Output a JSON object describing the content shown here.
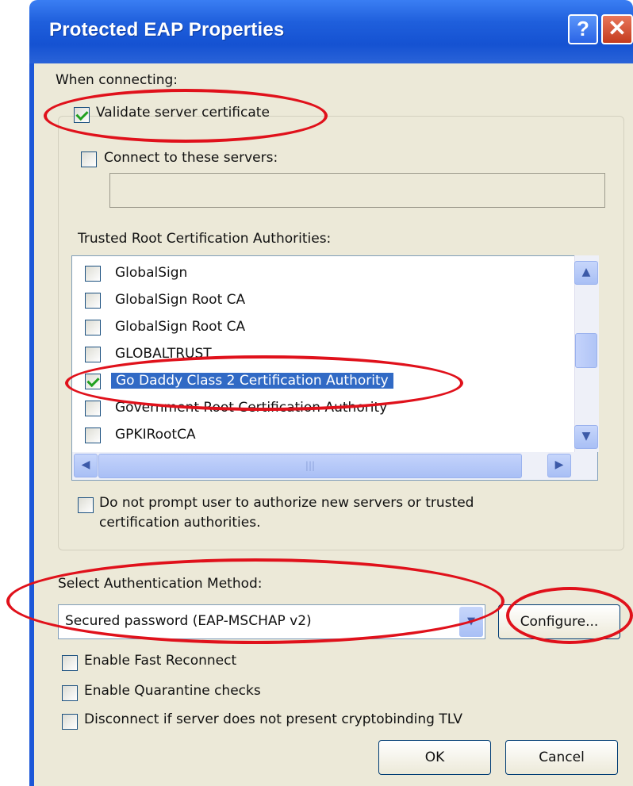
{
  "dialog": {
    "title": "Protected EAP Properties",
    "help_icon": "question-mark-icon",
    "close_icon": "close-x-icon"
  },
  "when_connecting": {
    "label": "When connecting:",
    "validate_cert": {
      "label": "Validate server certificate",
      "checked": true
    },
    "connect_servers": {
      "label": "Connect to these servers:",
      "checked": false,
      "value": ""
    }
  },
  "trusted_root": {
    "label": "Trusted Root Certification Authorities:",
    "items": [
      {
        "name": "GlobalSign",
        "checked": false,
        "selected": false
      },
      {
        "name": "GlobalSign Root CA",
        "checked": false,
        "selected": false
      },
      {
        "name": "GlobalSign Root CA",
        "checked": false,
        "selected": false
      },
      {
        "name": "GLOBALTRUST",
        "checked": false,
        "selected": false
      },
      {
        "name": "Go Daddy Class 2 Certification Authority",
        "checked": true,
        "selected": true
      },
      {
        "name": "Government Root Certification Authority",
        "checked": false,
        "selected": false
      },
      {
        "name": "GPKIRootCA",
        "checked": false,
        "selected": false
      }
    ]
  },
  "do_not_prompt": {
    "line1": "Do not prompt user to authorize new servers or trusted",
    "line2": "certification authorities.",
    "checked": false
  },
  "auth_method": {
    "label": "Select Authentication Method:",
    "selected": "Secured password (EAP-MSCHAP v2)",
    "configure_label": "Configure..."
  },
  "options": [
    {
      "label": "Enable Fast Reconnect",
      "checked": false
    },
    {
      "label": "Enable Quarantine checks",
      "checked": false
    },
    {
      "label": "Disconnect if server does not present cryptobinding TLV",
      "checked": false
    }
  ],
  "buttons": {
    "ok": "OK",
    "cancel": "Cancel"
  },
  "annotation_color": "#e0111b"
}
